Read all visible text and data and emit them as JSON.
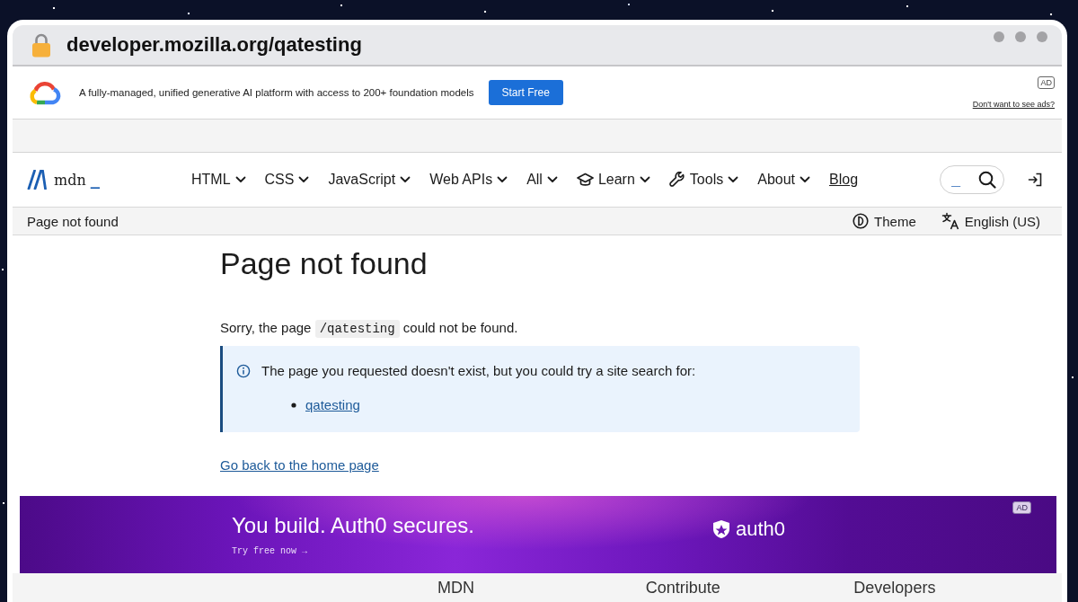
{
  "browser": {
    "url": "developer.mozilla.org/qatesting"
  },
  "ad": {
    "text": "A fully-managed, unified generative AI platform with access to 200+ foundation models",
    "button": "Start Free",
    "badge": "AD",
    "opt_out_link": "Don't want to see ads?"
  },
  "header": {
    "logo": {
      "name": "mdn",
      "suffix": "_"
    },
    "nav": [
      {
        "label": "HTML",
        "kind": "dropdown"
      },
      {
        "label": "CSS",
        "kind": "dropdown"
      },
      {
        "label": "JavaScript",
        "kind": "dropdown"
      },
      {
        "label": "Web APIs",
        "kind": "dropdown"
      },
      {
        "label": "All",
        "kind": "dropdown"
      },
      {
        "label": "Learn",
        "kind": "dropdown"
      },
      {
        "label": "Tools",
        "kind": "dropdown"
      },
      {
        "label": "About",
        "kind": "dropdown"
      },
      {
        "label": "Blog",
        "kind": "link"
      }
    ],
    "search": {
      "placeholder": "_"
    }
  },
  "toolbar": {
    "breadcrumb": "Page not found",
    "buttons": [
      "Theme",
      "English (US)"
    ]
  },
  "main": {
    "title": "Page not found",
    "message": {
      "before": "Sorry, the page",
      "code": "/qatesting",
      "after": "could not be found."
    },
    "callout": {
      "text": "The page you requested doesn't exist, but you could try a site search for:",
      "suggestions": [
        "qatesting"
      ]
    },
    "home_link": "Go back to the home page"
  },
  "banner": {
    "headline": "You build. Auth0 secures.",
    "cta": "Try free now →",
    "brand": "auth0",
    "badge": "AD"
  },
  "footer": {
    "columns": [
      "MDN",
      "Contribute",
      "Developers"
    ]
  }
}
